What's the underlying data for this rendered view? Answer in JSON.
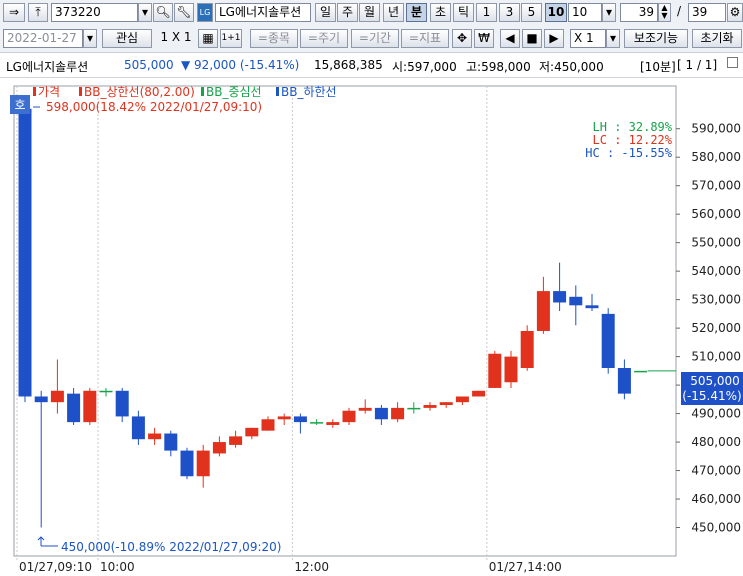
{
  "toolbar1": {
    "code": "373220",
    "name": "LG에너지솔루션",
    "periods": [
      "일",
      "주",
      "월",
      "년",
      "분",
      "초",
      "틱"
    ],
    "minutes": [
      "1",
      "3",
      "5",
      "10"
    ],
    "minute_value": "10",
    "count_value": "39",
    "count_total": "39"
  },
  "toolbar2": {
    "date": "2022-01-27",
    "interest": "관심",
    "layout": "1 X 1",
    "layout_small": "1+1",
    "items": [
      "=종목",
      "=주기",
      "=기간",
      "=지표"
    ],
    "won": "₩",
    "scale": "X 1",
    "aux": "보조기능",
    "reset": "초기화"
  },
  "info": {
    "name": "LG에너지솔루션",
    "price": "505,000",
    "change": "▼ 92,000 (-15.41%)",
    "volume": "15,868,385",
    "open": "시:597,000",
    "high": "고:598,000",
    "low": "저:450,000",
    "period": "[10분]",
    "page": "[ 1 / 1]"
  },
  "colors": {
    "up": "#e0321c",
    "down": "#1e50c8",
    "mid": "#16a34a",
    "blue_label": "#1a56c4"
  },
  "chart_data": {
    "type": "candlestick",
    "legend": [
      "가격",
      "BB_상한선(80,2.00)",
      "BB_중심선",
      "BB_하한선"
    ],
    "ylim": [
      440000,
      605000
    ],
    "y_ticks": [
      450000,
      460000,
      470000,
      480000,
      490000,
      500000,
      510000,
      520000,
      530000,
      540000,
      550000,
      560000,
      570000,
      580000,
      590000
    ],
    "y_tick_labels": [
      "450,000",
      "460,000",
      "470,000",
      "480,000",
      "490,000",
      "500,000",
      "510,000",
      "520,000",
      "530,000",
      "540,000",
      "550,000",
      "560,000",
      "570,000",
      "580,000",
      "590,000"
    ],
    "x_labels": [
      {
        "index": 0,
        "text": "01/27,09:10"
      },
      {
        "index": 5,
        "text": "10:00"
      },
      {
        "index": 17,
        "text": "12:00"
      },
      {
        "index": 29,
        "text": "01/27,14:00"
      }
    ],
    "candles": [
      {
        "o": 597000,
        "h": 598000,
        "l": 494000,
        "c": 496000
      },
      {
        "o": 496000,
        "h": 498000,
        "l": 450000,
        "c": 494000
      },
      {
        "o": 494000,
        "h": 509000,
        "l": 490000,
        "c": 498000
      },
      {
        "o": 497000,
        "h": 499000,
        "l": 486000,
        "c": 487000
      },
      {
        "o": 487000,
        "h": 499000,
        "l": 486000,
        "c": 498000
      },
      {
        "o": 498000,
        "h": 499000,
        "l": 496000,
        "c": 498000
      },
      {
        "o": 498000,
        "h": 499000,
        "l": 487000,
        "c": 489000
      },
      {
        "o": 489000,
        "h": 491000,
        "l": 479000,
        "c": 481000
      },
      {
        "o": 481000,
        "h": 485000,
        "l": 479000,
        "c": 483000
      },
      {
        "o": 483000,
        "h": 484000,
        "l": 475000,
        "c": 477000
      },
      {
        "o": 477000,
        "h": 478000,
        "l": 467000,
        "c": 468000
      },
      {
        "o": 468000,
        "h": 479000,
        "l": 464000,
        "c": 477000
      },
      {
        "o": 476000,
        "h": 482000,
        "l": 475000,
        "c": 480000
      },
      {
        "o": 479000,
        "h": 484000,
        "l": 478000,
        "c": 482000
      },
      {
        "o": 482000,
        "h": 485000,
        "l": 481000,
        "c": 485000
      },
      {
        "o": 484000,
        "h": 489000,
        "l": 484000,
        "c": 488000
      },
      {
        "o": 488000,
        "h": 490000,
        "l": 486000,
        "c": 489000
      },
      {
        "o": 489000,
        "h": 490000,
        "l": 483000,
        "c": 487000
      },
      {
        "o": 487000,
        "h": 488000,
        "l": 486000,
        "c": 487000
      },
      {
        "o": 486000,
        "h": 488000,
        "l": 485000,
        "c": 487000
      },
      {
        "o": 487000,
        "h": 492000,
        "l": 486000,
        "c": 491000
      },
      {
        "o": 491000,
        "h": 495000,
        "l": 490000,
        "c": 492000
      },
      {
        "o": 492000,
        "h": 493000,
        "l": 486000,
        "c": 488000
      },
      {
        "o": 488000,
        "h": 494000,
        "l": 487000,
        "c": 492000
      },
      {
        "o": 492000,
        "h": 494000,
        "l": 490000,
        "c": 492000
      },
      {
        "o": 492000,
        "h": 494000,
        "l": 491000,
        "c": 493000
      },
      {
        "o": 493000,
        "h": 494000,
        "l": 492000,
        "c": 494000
      },
      {
        "o": 494000,
        "h": 496000,
        "l": 493000,
        "c": 496000
      },
      {
        "o": 496000,
        "h": 498000,
        "l": 496000,
        "c": 498000
      },
      {
        "o": 499000,
        "h": 512000,
        "l": 499000,
        "c": 511000
      },
      {
        "o": 501000,
        "h": 512000,
        "l": 499000,
        "c": 510000
      },
      {
        "o": 506000,
        "h": 521000,
        "l": 505000,
        "c": 519000
      },
      {
        "o": 519000,
        "h": 538000,
        "l": 518000,
        "c": 533000
      },
      {
        "o": 533000,
        "h": 543000,
        "l": 526000,
        "c": 529000
      },
      {
        "o": 531000,
        "h": 535000,
        "l": 521000,
        "c": 528000
      },
      {
        "o": 528000,
        "h": 532000,
        "l": 526000,
        "c": 527000
      },
      {
        "o": 525000,
        "h": 527000,
        "l": 504000,
        "c": 506000
      },
      {
        "o": 506000,
        "h": 509000,
        "l": 495000,
        "c": 497000
      },
      {
        "o": 505000,
        "h": 505000,
        "l": 505000,
        "c": 505000
      }
    ],
    "annotations": {
      "max": "598,000(18.42% 2022/01/27,09:10)",
      "min": "450,000(-10.89% 2022/01/27,09:20)",
      "lh": "LH :  32.89%",
      "lc": "LC :  12.22%",
      "hc": "HC : -15.55%",
      "badge": "호",
      "current": "505,000",
      "current_pct": "(-15.41%)"
    }
  }
}
